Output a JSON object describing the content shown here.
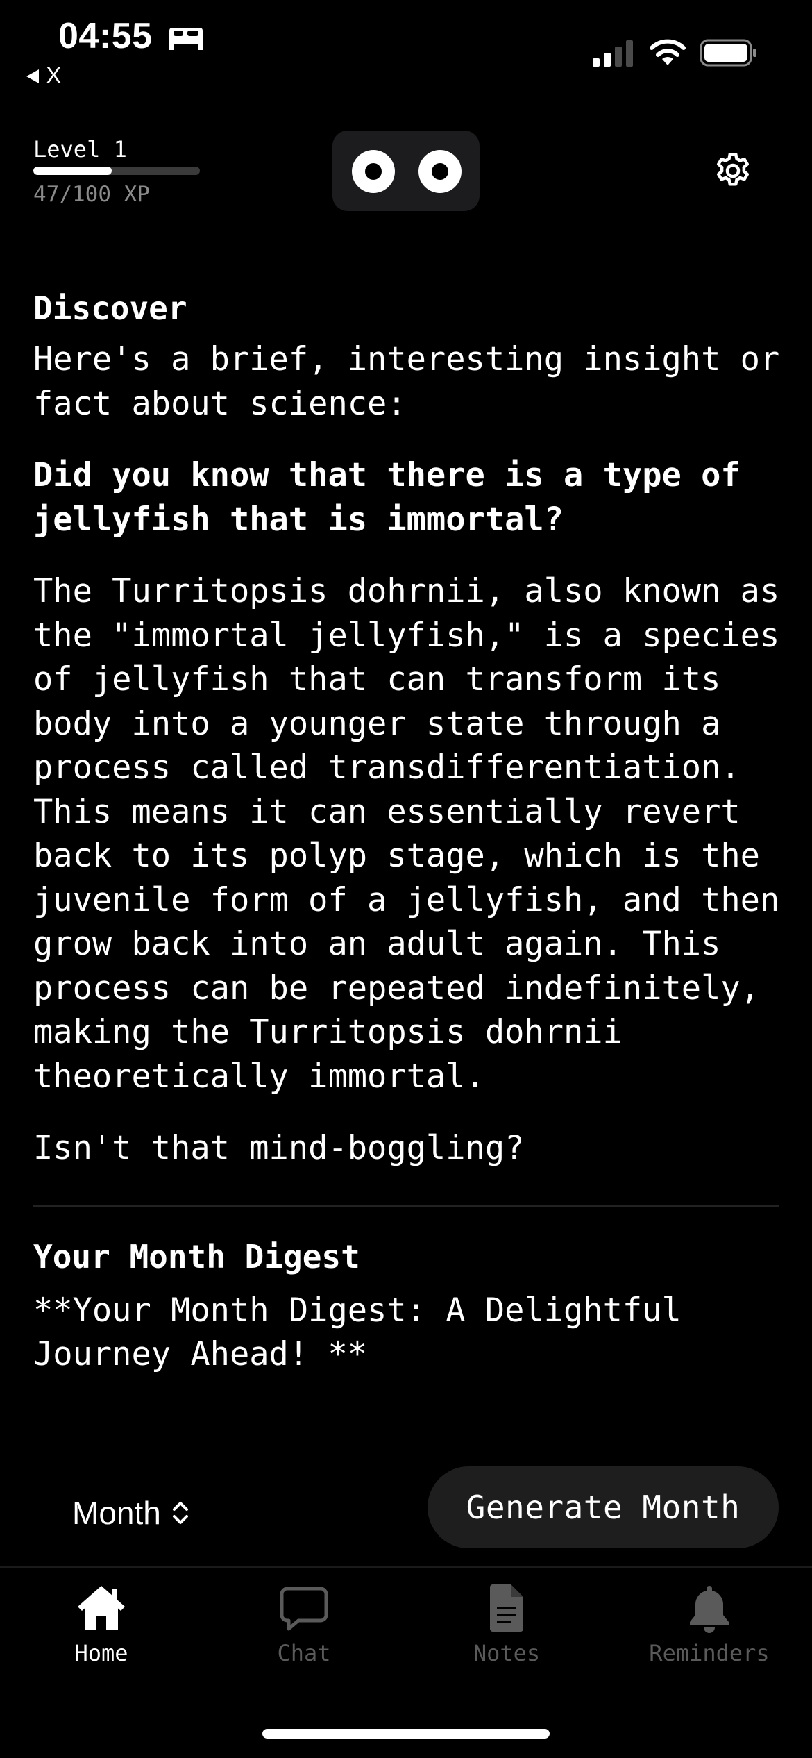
{
  "status_bar": {
    "time": "04:55",
    "back_label": "X",
    "icons": [
      "bed-icon",
      "signal-icon",
      "wifi-icon",
      "battery-icon"
    ]
  },
  "header": {
    "level_label": "Level 1",
    "xp_text": "47/100 XP",
    "xp_progress": 0.47,
    "mascot_icon": "eyes-icon",
    "settings_icon": "gear-icon"
  },
  "discover": {
    "title": "Discover",
    "intro": "Here's a brief, interesting insight or fact about science:",
    "headline": "Did you know that there is a type of jellyfish that is immortal?",
    "body": "The Turritopsis dohrnii, also known as the \"immortal jellyfish,\" is a species of jellyfish that can transform its body into a younger state through a process called transdifferentiation. This means it can essentially revert back to its polyp stage, which is the juvenile form of a jellyfish, and then grow back into an adult again. This process can be repeated indefinitely, making the Turritopsis dohrnii theoretically immortal.",
    "closing": "Isn't that mind-boggling?"
  },
  "digest": {
    "title": "Your Month Digest",
    "text": "**Your Month Digest: A Delightful Journey Ahead! **"
  },
  "controls": {
    "period_value": "Month",
    "generate_label": "Generate Month"
  },
  "tabs": [
    {
      "label": "Home",
      "icon": "home-icon",
      "active": true
    },
    {
      "label": "Chat",
      "icon": "chat-bubble-icon",
      "active": false
    },
    {
      "label": "Notes",
      "icon": "document-icon",
      "active": false
    },
    {
      "label": "Reminders",
      "icon": "bell-icon",
      "active": false
    }
  ],
  "colors": {
    "background": "#000000",
    "text": "#ffffff",
    "muted": "#8a8a8a",
    "inactive_tab": "#5a5a5a",
    "button_bg": "#1e1e1e"
  }
}
